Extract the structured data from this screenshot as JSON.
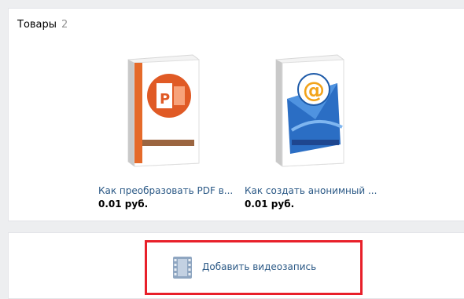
{
  "goods": {
    "title": "Товары",
    "count": "2",
    "items": [
      {
        "title": "Как преобразовать PDF в...",
        "price": "0.01 руб.",
        "cover_icon": "powerpoint-icon",
        "cover_color": "#e05a25"
      },
      {
        "title": "Как создать анонимный ...",
        "price": "0.01 руб.",
        "cover_icon": "email-at-icon",
        "cover_color": "#2b6ec4"
      }
    ]
  },
  "video": {
    "add_label": "Добавить видеозапись",
    "icon": "film-icon"
  },
  "colors": {
    "link": "#2a5885",
    "highlight": "#e8202a",
    "background": "#edeef0"
  }
}
